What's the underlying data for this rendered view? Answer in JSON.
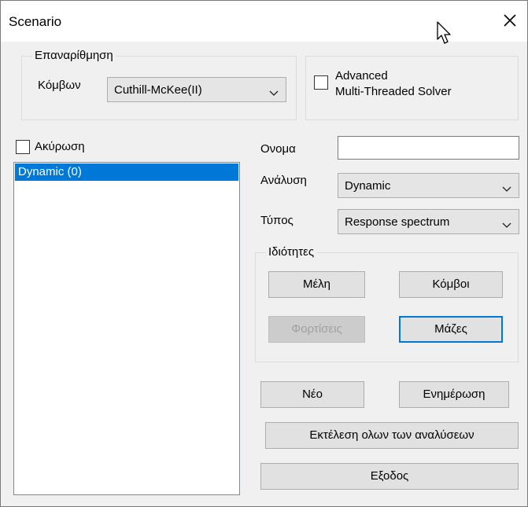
{
  "window": {
    "title": "Scenario"
  },
  "renumbering": {
    "group_label": "Επαναρίθμηση",
    "nodes_label": "Κόμβων",
    "method_value": "Cuthill-McKee(II)"
  },
  "solver": {
    "checkbox_line1": "Advanced",
    "checkbox_line2": "Multi-Threaded Solver",
    "checked": false
  },
  "cancel": {
    "label": "Ακύρωση",
    "checked": false
  },
  "scenarios": {
    "items": [
      {
        "label": "Dynamic  (0)",
        "selected": true
      }
    ]
  },
  "form": {
    "name_label": "Ονομα",
    "name_value": "",
    "analysis_label": "Ανάλυση",
    "analysis_value": "Dynamic",
    "type_label": "Τύπος",
    "type_value": "Response spectrum"
  },
  "properties": {
    "group_label": "Ιδιότητες",
    "members_button": "Μέλη",
    "nodes_button": "Κόμβοι",
    "loads_button": "Φορτίσεις",
    "masses_button": "Μάζες"
  },
  "actions": {
    "new_button": "Νέο",
    "update_button": "Ενημέρωση",
    "run_all_button": "Εκτέλεση ολων των αναλύσεων",
    "exit_button": "Εξοδος"
  },
  "colors": {
    "selection": "#0078d7",
    "dialog_bg": "#f0f0f0",
    "focus_border": "#0078d7"
  },
  "icons": {
    "close": "close-icon",
    "cursor": "mouse-pointer-icon",
    "dropdown": "chevron-down-icon"
  }
}
